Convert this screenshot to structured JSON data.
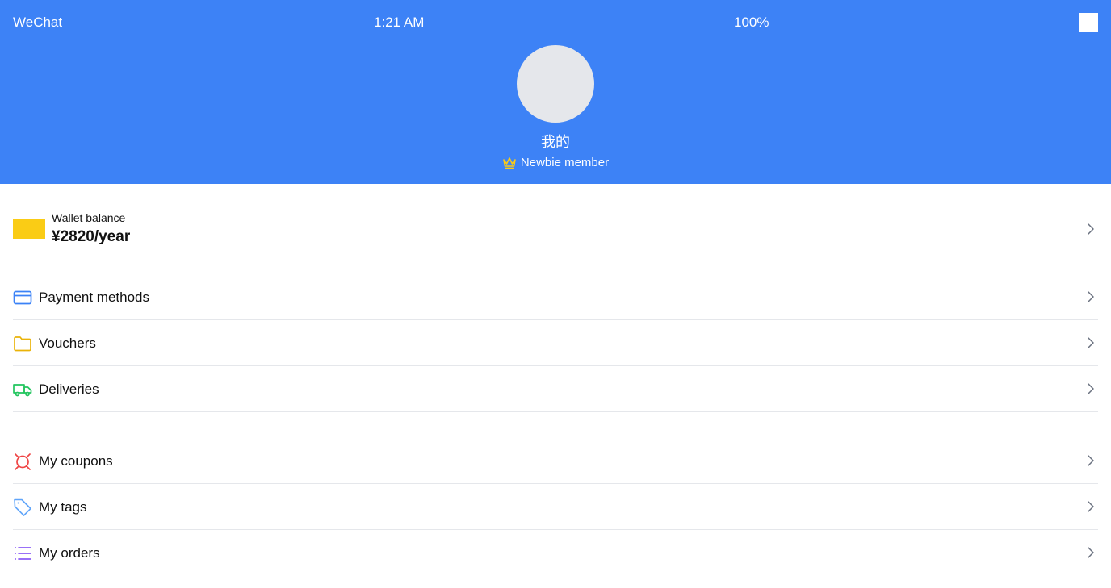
{
  "status_bar": {
    "app_name": "WeChat",
    "time": "1:21 AM",
    "battery": "100%"
  },
  "profile": {
    "username": "我的",
    "member_level": "Newbie member"
  },
  "wallet": {
    "label": "Wallet balance",
    "amount": "¥2820/year"
  },
  "menu_group_1": [
    {
      "label": "Payment methods",
      "icon": "credit-card-icon",
      "color": "#3b82f6"
    },
    {
      "label": "Vouchers",
      "icon": "folder-icon",
      "color": "#eab308"
    },
    {
      "label": "Deliveries",
      "icon": "truck-icon",
      "color": "#22c55e"
    }
  ],
  "menu_group_2": [
    {
      "label": "My coupons",
      "icon": "coupon-icon",
      "color": "#ef4444"
    },
    {
      "label": "My tags",
      "icon": "tag-icon",
      "color": "#60a5fa"
    },
    {
      "label": "My orders",
      "icon": "list-icon",
      "color": "#8b5cf6"
    }
  ],
  "colors": {
    "header_bg": "#3d82f6",
    "crown": "#facc15",
    "wallet_card": "#facc15"
  }
}
